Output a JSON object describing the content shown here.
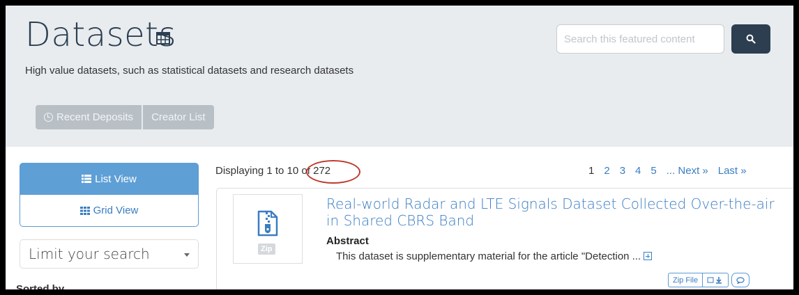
{
  "header": {
    "title": "Datasets",
    "title_icon": "table-icon",
    "subtitle": "High value datasets, such as statistical datasets and research datasets",
    "search": {
      "placeholder": "Search this featured content",
      "button_icon": "search-icon"
    },
    "buttons": [
      {
        "label": "Recent Deposits",
        "icon": "clock-icon"
      },
      {
        "label": "Creator List"
      }
    ]
  },
  "colors": {
    "header_bg": "#e8ecef",
    "accent": "#3a7dc2",
    "active_tab": "#5e9fd6",
    "search_btn": "#2c3e50",
    "annotation_circle": "#c0392b"
  },
  "sidebar": {
    "tabs": [
      {
        "label": "List View",
        "icon": "list-icon",
        "active": true
      },
      {
        "label": "Grid View",
        "icon": "grid-icon",
        "active": false
      }
    ],
    "limit_label": "Limit your search",
    "sorted_label": "Sorted by"
  },
  "results": {
    "displaying_prefix": "Displaying 1 to 10",
    "displaying_suffix": "of 272",
    "pages": [
      "1",
      "2",
      "3",
      "4",
      "5"
    ],
    "ellipsis_next": "... Next »",
    "last": "Last »"
  },
  "item": {
    "thumb_badge": "Zip",
    "title": "Real-world Radar and LTE Signals Dataset Collected Over-the-air in Shared CBRS Band",
    "abstract_label": "Abstract",
    "abstract_text": "This dataset is supplementary material for the article \"Detection ...",
    "actions": {
      "zip_file": "Zip File"
    }
  }
}
